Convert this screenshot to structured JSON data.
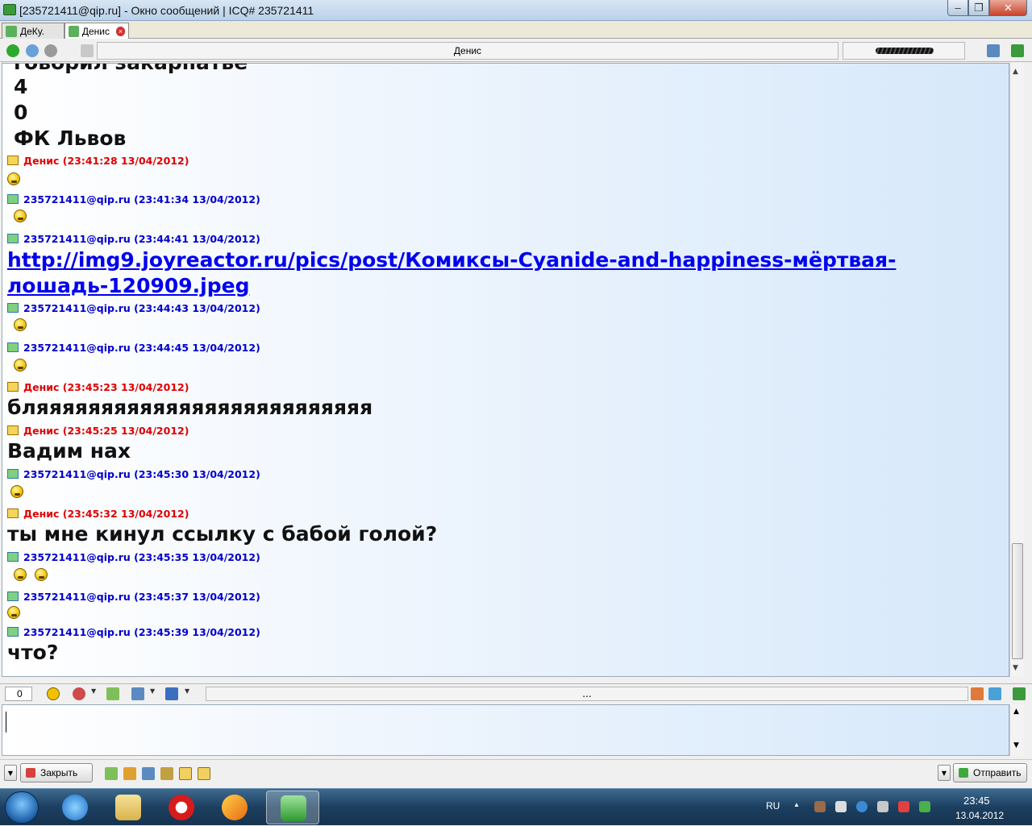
{
  "window": {
    "title": "[235721411@qip.ru] - Окно сообщений | ICQ# 235721411",
    "min": "–",
    "max": "❐",
    "close": "✕"
  },
  "tabs": [
    {
      "label": "ДеКу."
    },
    {
      "label": "Денис",
      "close": "×"
    }
  ],
  "info": {
    "contact": "Денис"
  },
  "messages": {
    "partial_top": "говорил закарпатье",
    "l1": "4",
    "l2": "0",
    "l3": "ФК Львов",
    "h1": "Денис (23:41:28 13/04/2012)",
    "h2": "235721411@qip.ru (23:41:34 13/04/2012)",
    "h3": "235721411@qip.ru (23:44:41 13/04/2012)",
    "link1": "http://img9.joyreactor.ru/pics/post/Комиксы-Cyanide-and-happiness-мёртвая-",
    "link2": "лошадь-120909.jpeg",
    "h4": "235721411@qip.ru (23:44:43 13/04/2012)",
    "h5": "235721411@qip.ru (23:44:45 13/04/2012)",
    "h6": "Денис (23:45:23 13/04/2012)",
    "t6": "бляяяяяяяяяяяяяяяяяяяяяяяяяя",
    "h7": "Денис (23:45:25 13/04/2012)",
    "t7": "Вадим нах",
    "h8": "235721411@qip.ru (23:45:30 13/04/2012)",
    "h9": "Денис (23:45:32 13/04/2012)",
    "t9": "ты мне кинул ссылку с бабой голой?",
    "h10": "235721411@qip.ru (23:45:35 13/04/2012)",
    "h11": "235721411@qip.ru (23:45:37 13/04/2012)",
    "h12": "235721411@qip.ru (23:45:39 13/04/2012)",
    "t12": "что?"
  },
  "toolbar2": {
    "counter": "0",
    "dots": "..."
  },
  "bottom": {
    "close_label": "Закрыть",
    "send_label": "Отправить"
  },
  "taskbar": {
    "lang": "RU",
    "time": "23:45",
    "date": "13.04.2012"
  },
  "colors": {
    "own_nick": "#e00000",
    "peer_nick": "#0000cc",
    "link": "#0000ee"
  }
}
